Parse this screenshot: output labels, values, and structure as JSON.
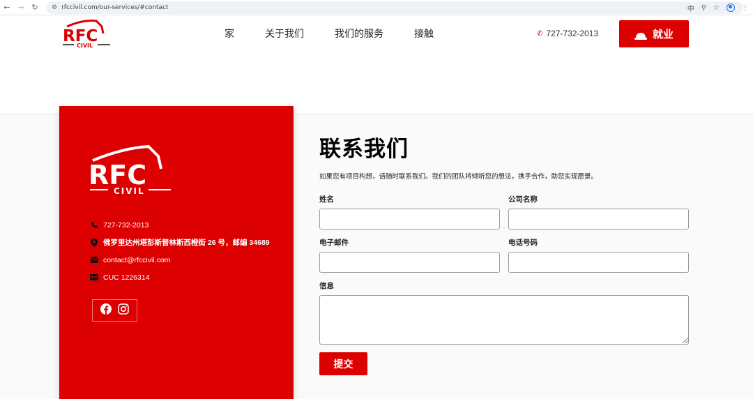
{
  "browser": {
    "url": "rfccivil.com/our-services/#contact"
  },
  "header": {
    "logo_top": "RFC",
    "logo_bottom": "CIVIL",
    "nav": [
      "家",
      "关于我们",
      "我们的服务",
      "接触"
    ],
    "phone": "727-732-2013",
    "jobs_label": "就业"
  },
  "panel": {
    "logo_top": "RFC",
    "logo_bottom": "CIVIL",
    "phone": "727-732-2013",
    "address": "佛罗里达州塔彭斯普林斯西橙街 26 号，邮编 34689",
    "email": "contact@rfccivil.com",
    "license": "CUC 1226314"
  },
  "form": {
    "title": "联系我们",
    "description": "如果您有项目构想，请随时联系我们。我们的团队将倾听您的想法，携手合作，助您实现愿景。",
    "name_label": "姓名",
    "company_label": "公司名称",
    "email_label": "电子邮件",
    "phone_label": "电话号码",
    "message_label": "信息",
    "submit_label": "提交"
  },
  "colors": {
    "brand_red": "#dc0000"
  }
}
